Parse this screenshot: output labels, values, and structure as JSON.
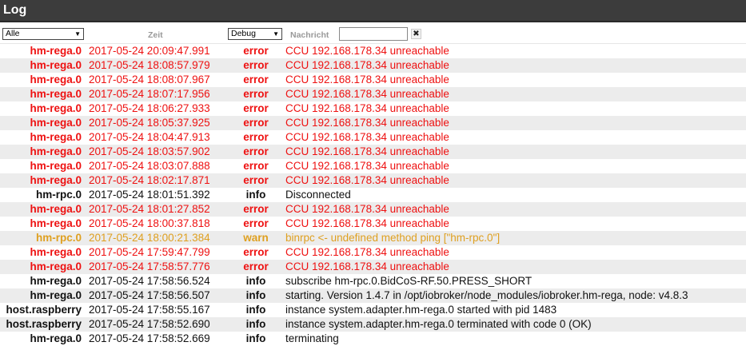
{
  "title": "Log",
  "filters": {
    "source_value": "Alle",
    "time_label": "Zeit",
    "level_value": "Debug",
    "message_label": "Nachricht",
    "message_value": "",
    "clear_glyph": "✖"
  },
  "rows": [
    {
      "src": "hm-rega.0",
      "time": "2017-05-24 20:09:47.991",
      "sev": "error",
      "msg": "CCU 192.168.178.34 unreachable"
    },
    {
      "src": "hm-rega.0",
      "time": "2017-05-24 18:08:57.979",
      "sev": "error",
      "msg": "CCU 192.168.178.34 unreachable"
    },
    {
      "src": "hm-rega.0",
      "time": "2017-05-24 18:08:07.967",
      "sev": "error",
      "msg": "CCU 192.168.178.34 unreachable"
    },
    {
      "src": "hm-rega.0",
      "time": "2017-05-24 18:07:17.956",
      "sev": "error",
      "msg": "CCU 192.168.178.34 unreachable"
    },
    {
      "src": "hm-rega.0",
      "time": "2017-05-24 18:06:27.933",
      "sev": "error",
      "msg": "CCU 192.168.178.34 unreachable"
    },
    {
      "src": "hm-rega.0",
      "time": "2017-05-24 18:05:37.925",
      "sev": "error",
      "msg": "CCU 192.168.178.34 unreachable"
    },
    {
      "src": "hm-rega.0",
      "time": "2017-05-24 18:04:47.913",
      "sev": "error",
      "msg": "CCU 192.168.178.34 unreachable"
    },
    {
      "src": "hm-rega.0",
      "time": "2017-05-24 18:03:57.902",
      "sev": "error",
      "msg": "CCU 192.168.178.34 unreachable"
    },
    {
      "src": "hm-rega.0",
      "time": "2017-05-24 18:03:07.888",
      "sev": "error",
      "msg": "CCU 192.168.178.34 unreachable"
    },
    {
      "src": "hm-rega.0",
      "time": "2017-05-24 18:02:17.871",
      "sev": "error",
      "msg": "CCU 192.168.178.34 unreachable"
    },
    {
      "src": "hm-rpc.0",
      "time": "2017-05-24 18:01:51.392",
      "sev": "info",
      "msg": "Disconnected"
    },
    {
      "src": "hm-rega.0",
      "time": "2017-05-24 18:01:27.852",
      "sev": "error",
      "msg": "CCU 192.168.178.34 unreachable"
    },
    {
      "src": "hm-rega.0",
      "time": "2017-05-24 18:00:37.818",
      "sev": "error",
      "msg": "CCU 192.168.178.34 unreachable"
    },
    {
      "src": "hm-rpc.0",
      "time": "2017-05-24 18:00:21.384",
      "sev": "warn",
      "msg": "binrpc <- undefined method ping [\"hm-rpc.0\"]"
    },
    {
      "src": "hm-rega.0",
      "time": "2017-05-24 17:59:47.799",
      "sev": "error",
      "msg": "CCU 192.168.178.34 unreachable"
    },
    {
      "src": "hm-rega.0",
      "time": "2017-05-24 17:58:57.776",
      "sev": "error",
      "msg": "CCU 192.168.178.34 unreachable"
    },
    {
      "src": "hm-rega.0",
      "time": "2017-05-24 17:58:56.524",
      "sev": "info",
      "msg": "subscribe hm-rpc.0.BidCoS-RF.50.PRESS_SHORT"
    },
    {
      "src": "hm-rega.0",
      "time": "2017-05-24 17:58:56.507",
      "sev": "info",
      "msg": "starting. Version 1.4.7 in /opt/iobroker/node_modules/iobroker.hm-rega, node: v4.8.3"
    },
    {
      "src": "host.raspberry",
      "time": "2017-05-24 17:58:55.167",
      "sev": "info",
      "msg": "instance system.adapter.hm-rega.0 started with pid 1483"
    },
    {
      "src": "host.raspberry",
      "time": "2017-05-24 17:58:52.690",
      "sev": "info",
      "msg": "instance system.adapter.hm-rega.0 terminated with code 0 (OK)"
    },
    {
      "src": "hm-rega.0",
      "time": "2017-05-24 17:58:52.669",
      "sev": "info",
      "msg": "terminating"
    }
  ]
}
